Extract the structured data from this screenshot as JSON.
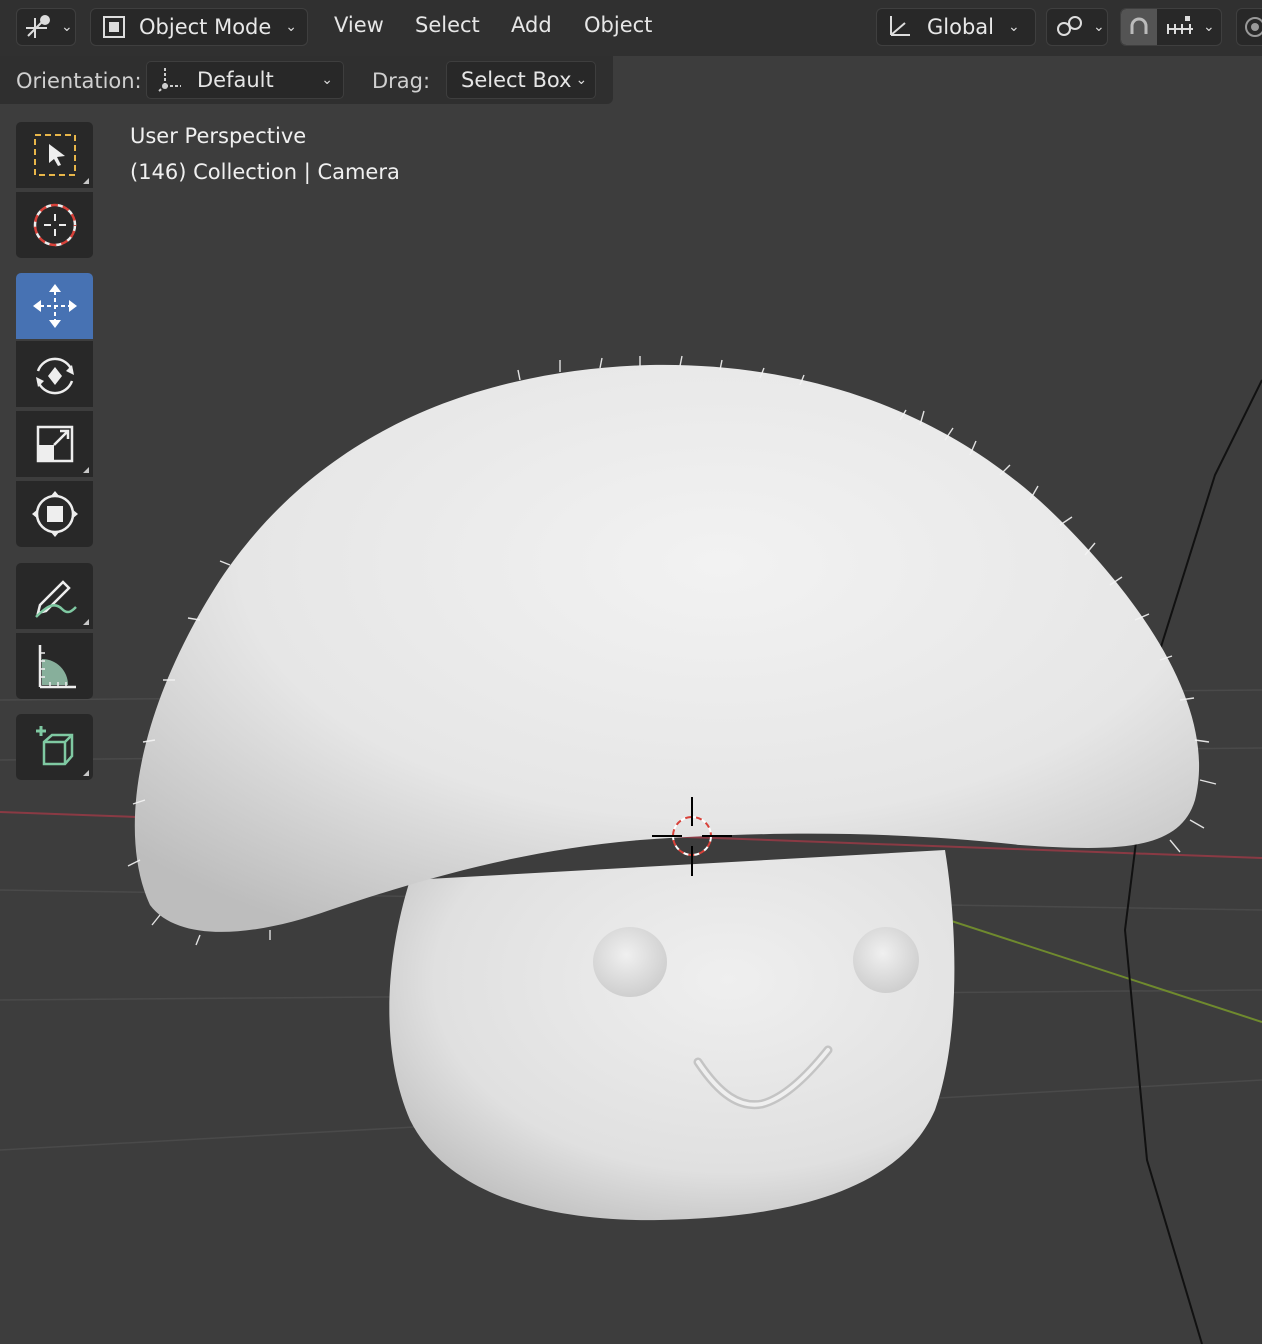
{
  "header": {
    "editor_type_icon": "3d-viewport-icon",
    "mode": "Object Mode",
    "menus": [
      "View",
      "Select",
      "Add",
      "Object"
    ],
    "transform_orientation": "Global",
    "pivot_icon": "link-pivot-icon",
    "snap_icon": "magnet-snap-icon",
    "snap_increment_icon": "snap-increment-icon"
  },
  "tool_settings": {
    "orientation_label": "Orientation:",
    "orientation_value": "Default",
    "drag_label": "Drag:",
    "drag_value": "Select Box"
  },
  "viewport": {
    "perspective": "User Perspective",
    "collection_info": "(146) Collection | Camera"
  },
  "toolbar": {
    "tools": [
      {
        "name": "select-box-tool",
        "active": false
      },
      {
        "name": "cursor-tool",
        "active": false
      },
      {
        "name": "move-tool",
        "active": true
      },
      {
        "name": "rotate-tool",
        "active": false
      },
      {
        "name": "scale-tool",
        "active": false
      },
      {
        "name": "transform-tool",
        "active": false
      },
      {
        "name": "annotate-tool",
        "active": false
      },
      {
        "name": "measure-tool",
        "active": false
      },
      {
        "name": "add-cube-tool",
        "active": false
      }
    ]
  },
  "colors": {
    "header_bg": "#303030",
    "viewport_bg": "#3d3d3d",
    "active_tool": "#4772b3",
    "x_axis": "#8a3a44",
    "y_axis": "#6f8a2e"
  }
}
